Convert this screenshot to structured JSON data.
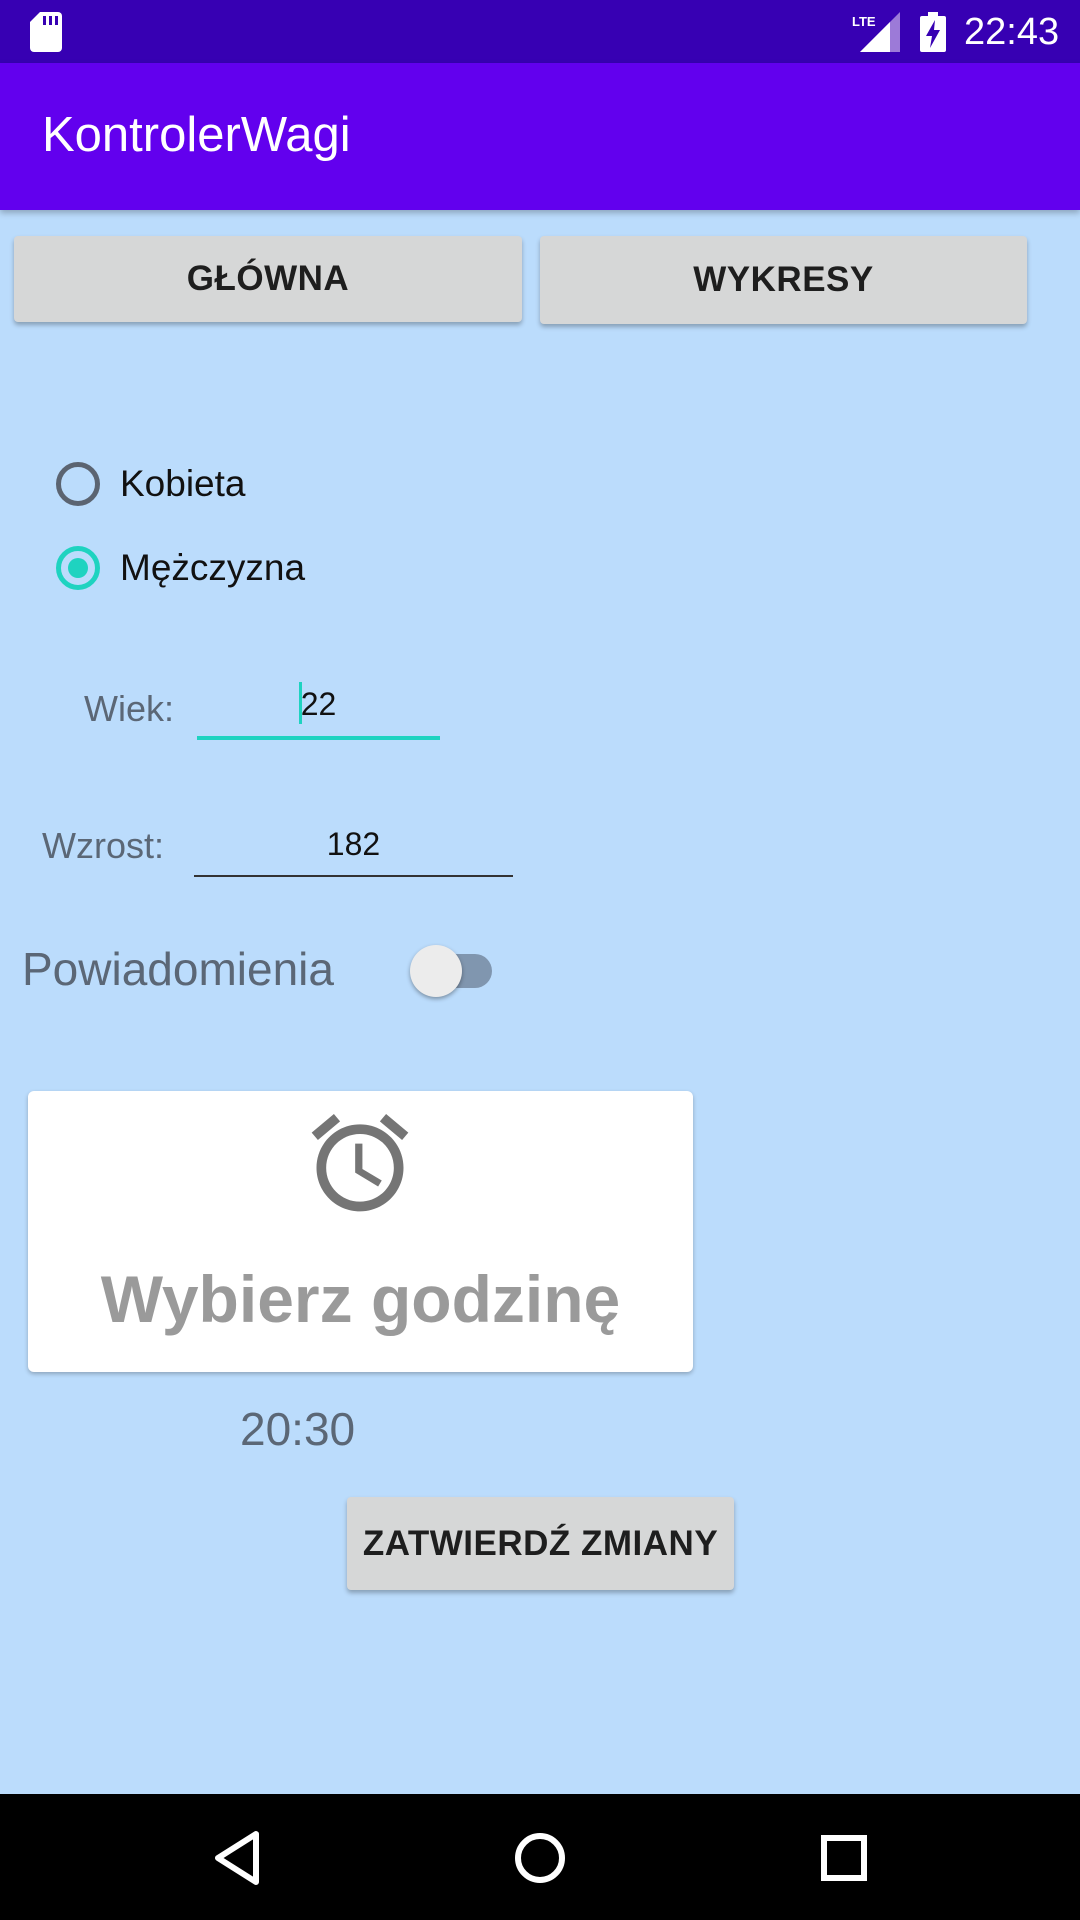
{
  "status_bar": {
    "time": "22:43",
    "icons": [
      "sd-card-icon",
      "lte-signal-icon",
      "battery-charging-icon"
    ]
  },
  "app_bar": {
    "title": "KontrolerWagi"
  },
  "tabs": {
    "main_label": "GŁÓWNA",
    "charts_label": "WYKRESY"
  },
  "gender": {
    "options": [
      {
        "label": "Kobieta",
        "selected": false
      },
      {
        "label": "Mężczyzna",
        "selected": true
      }
    ]
  },
  "form": {
    "age_label": "Wiek:",
    "age_value": "22",
    "height_label": "Wzrost:",
    "height_value": "182"
  },
  "notifications": {
    "label": "Powiadomienia",
    "enabled": false
  },
  "time_picker": {
    "icon": "alarm-clock-icon",
    "prompt": "Wybierz godzinę",
    "selected_time": "20:30"
  },
  "submit": {
    "label": "ZATWIERDŹ ZMIANY"
  },
  "colors": {
    "status_bar": "#3700b3",
    "app_bar": "#6200ee",
    "background": "#bbdcfc",
    "accent": "#1ed3c0",
    "button": "#d6d7d7"
  },
  "nav_bar": {
    "icons": [
      "back-icon",
      "home-icon",
      "recents-icon"
    ]
  }
}
